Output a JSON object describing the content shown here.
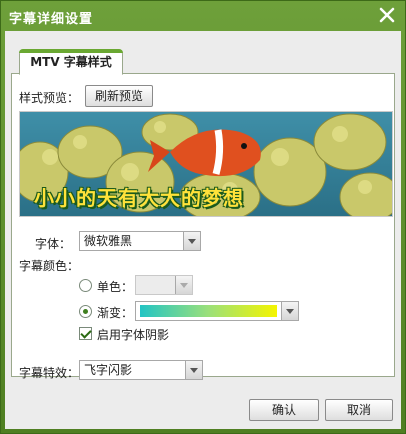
{
  "window": {
    "title": "字幕详细设置"
  },
  "tab": {
    "label": "MTV 字幕样式"
  },
  "preview": {
    "label": "样式预览：",
    "refresh_button": "刷新预览",
    "caption": "小小的天有大大的梦想"
  },
  "font": {
    "label": "字体：",
    "value": "微软雅黑"
  },
  "subtitle_color": {
    "label": "字幕颜色：",
    "solid_label": "单色：",
    "solid_value": "",
    "gradient_label": "渐变：",
    "selected": "gradient",
    "gradient_colors": [
      "#22c4c4",
      "#9be07a",
      "#f5f500"
    ]
  },
  "shadow": {
    "label": "启用字体阴影",
    "checked": true
  },
  "effect": {
    "label": "字幕特效：",
    "value": "飞字闪影"
  },
  "footer": {
    "ok_label": "确认",
    "cancel_label": "取消"
  },
  "colors": {
    "titlebar": "#5b8a2e",
    "accent": "#6aa832",
    "caption_fill": "#ffe23a",
    "caption_outline": "#1b5a1b"
  }
}
